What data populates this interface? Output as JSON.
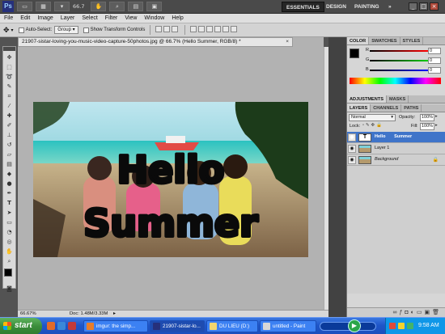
{
  "app": {
    "logo": "Ps",
    "zoom_display": "66.7",
    "workspaces": [
      "ESSENTIALS",
      "DESIGN",
      "PAINTING",
      "»"
    ]
  },
  "menu": [
    "File",
    "Edit",
    "Image",
    "Layer",
    "Select",
    "Filter",
    "View",
    "Window",
    "Help"
  ],
  "options": {
    "auto_select_label": "Auto-Select:",
    "auto_select_value": "Group",
    "transform_label": "Show Transform Controls"
  },
  "document": {
    "tab_title": "21907-sistar-loving-you-music-video-capture-50photos.jpg @ 66.7% (Hello      Summer, RGB/8) *",
    "canvas_text_line1": "Hello",
    "canvas_text_line2": "Summer"
  },
  "status": {
    "zoom": "66.67%",
    "doc_size": "Doc: 1.48M/3.33M"
  },
  "color_panel": {
    "tabs": [
      "COLOR",
      "SWATCHES",
      "STYLES"
    ],
    "channels": [
      {
        "label": "R",
        "value": "0"
      },
      {
        "label": "G",
        "value": "0"
      },
      {
        "label": "B",
        "value": "0"
      }
    ],
    "fg_color": "#000000",
    "bg_color": "#ffffff"
  },
  "adjustments_panel": {
    "tabs": [
      "ADJUSTMENTS",
      "MASKS"
    ]
  },
  "layers_panel": {
    "tabs": [
      "LAYERS",
      "CHANNELS",
      "PATHS"
    ],
    "blend_mode": "Normal",
    "opacity_label": "Opacity:",
    "opacity_value": "100%",
    "lock_label": "Lock:",
    "fill_label": "Fill:",
    "fill_value": "100%",
    "layers": [
      {
        "name": "Hello       Summer",
        "type": "text",
        "selected": true
      },
      {
        "name": "Layer 1",
        "type": "image",
        "selected": false
      },
      {
        "name": "Background",
        "type": "image",
        "selected": false,
        "locked": true
      }
    ]
  },
  "taskbar": {
    "start_label": "start",
    "tasks": [
      {
        "label": "imgur: the simp...",
        "active": false
      },
      {
        "label": "21907-sistar-lo...",
        "active": true
      },
      {
        "label": "DU LIEU (D:)",
        "active": false
      },
      {
        "label": "untitled - Paint",
        "active": false
      }
    ],
    "clock": "9:58 AM"
  }
}
